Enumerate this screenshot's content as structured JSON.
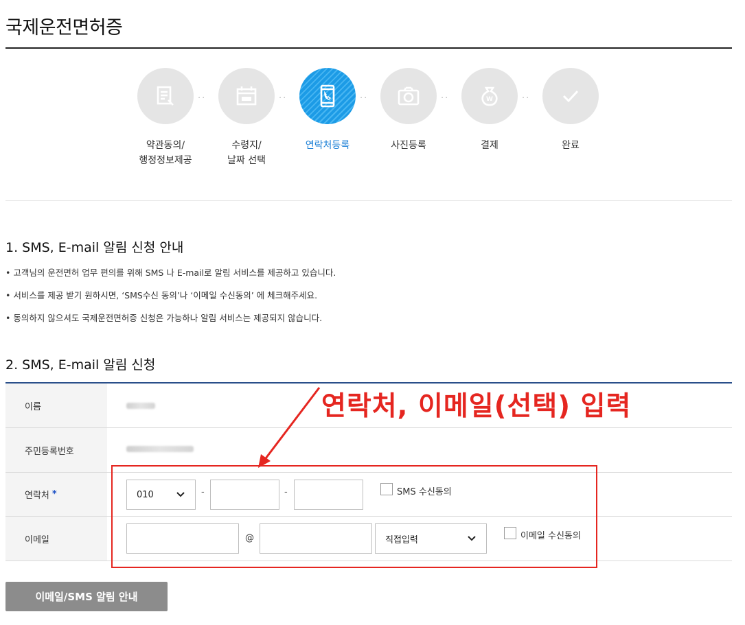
{
  "page": {
    "title": "국제운전면허증"
  },
  "steps": [
    {
      "label": "약관동의/\n행정정보제공",
      "icon": "document-icon",
      "active": false
    },
    {
      "label": "수령지/\n날짜 선택",
      "icon": "calendar-icon",
      "active": false
    },
    {
      "label": "연락처등록",
      "icon": "phone-icon",
      "active": true
    },
    {
      "label": "사진등록",
      "icon": "camera-icon",
      "active": false
    },
    {
      "label": "결제",
      "icon": "money-bag-icon",
      "active": false
    },
    {
      "label": "완료",
      "icon": "check-icon",
      "active": false
    }
  ],
  "section1": {
    "heading": "1. SMS, E-mail 알림 신청 안내",
    "bullets": [
      "• 고객님의 운전면허 업무 편의를 위해 SMS 나 E-mail로 알림 서비스를 제공하고 있습니다.",
      "• 서비스를 제공 받기 원하시면, ‘SMS수신 동의’나 ‘이메일 수신동의’ 에 체크해주세요.",
      "• 동의하지 않으셔도 국제운전면허증 신청은 가능하나 알림 서비스는 제공되지 않습니다."
    ]
  },
  "section2": {
    "heading": "2. SMS, E-mail 알림 신청"
  },
  "form": {
    "name_label": "이름",
    "rrn_label": "주민등록번호",
    "phone_label": "연락처",
    "required_mark": "*",
    "phone_prefix": "010",
    "phone_sep": "-",
    "sms_consent_label": "SMS 수신동의",
    "email_label": "이메일",
    "email_at": "@",
    "email_domain_select": "직접입력",
    "email_consent_label": "이메일 수신동의"
  },
  "annotation": {
    "text": "연락처, 이메일(선택) 입력"
  },
  "button": {
    "notice_label": "이메일/SMS 알림 안내"
  },
  "colors": {
    "accent": "#1a7fd6",
    "annotation_red": "#e52620",
    "button_gray": "#8c8c8c"
  }
}
